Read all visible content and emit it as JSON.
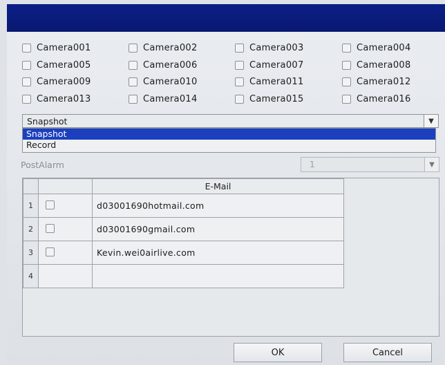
{
  "cameras": [
    "Camera001",
    "Camera002",
    "Camera003",
    "Camera004",
    "Camera005",
    "Camera006",
    "Camera007",
    "Camera008",
    "Camera009",
    "Camera010",
    "Camera011",
    "Camera012",
    "Camera013",
    "Camera014",
    "Camera015",
    "Camera016"
  ],
  "action_select": {
    "value": "Snapshot",
    "options": [
      "Snapshot",
      "Record"
    ],
    "highlighted": "Snapshot"
  },
  "post_alarm": {
    "label": "PostAlarm",
    "value": "1"
  },
  "email_table": {
    "header": "E-Mail",
    "rows": [
      {
        "num": "1",
        "email": "d03001690hotmail.com"
      },
      {
        "num": "2",
        "email": "d03001690gmail.com"
      },
      {
        "num": "3",
        "email": "Kevin.wei0airlive.com"
      },
      {
        "num": "4",
        "email": ""
      }
    ]
  },
  "buttons": {
    "ok": "OK",
    "cancel": "Cancel"
  },
  "colors": {
    "title_bar": "#0b1f88",
    "selection": "#1b3fbf"
  }
}
